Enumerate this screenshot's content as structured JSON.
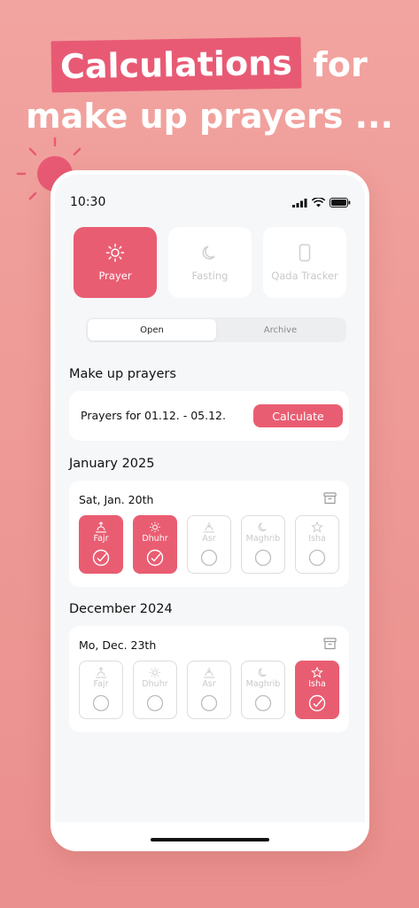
{
  "headline": {
    "highlight": "Calculations",
    "rest_line1": " for",
    "line2": "make up prayers ..."
  },
  "status_bar": {
    "time": "10:30"
  },
  "modes": [
    {
      "label": "Prayer",
      "icon": "sun-icon",
      "active": true
    },
    {
      "label": "Fasting",
      "icon": "moon-icon",
      "active": false
    },
    {
      "label": "Qada Tracker",
      "icon": "phone-icon",
      "active": false
    }
  ],
  "segment": {
    "open": "Open",
    "archive": "Archive",
    "selected": "Open"
  },
  "makeup": {
    "title": "Make up prayers",
    "range_text": "Prayers for 01.12. - 05.12.",
    "button": "Calculate"
  },
  "months": [
    {
      "title": "January 2025",
      "day": "Sat, Jan. 20th",
      "prayers": [
        {
          "name": "Fajr",
          "done": true
        },
        {
          "name": "Dhuhr",
          "done": true
        },
        {
          "name": "Asr",
          "done": false
        },
        {
          "name": "Maghrib",
          "done": false
        },
        {
          "name": "Isha",
          "done": false
        }
      ]
    },
    {
      "title": "December 2024",
      "day": "Mo, Dec. 23th",
      "prayers": [
        {
          "name": "Fajr",
          "done": false
        },
        {
          "name": "Dhuhr",
          "done": false
        },
        {
          "name": "Asr",
          "done": false
        },
        {
          "name": "Maghrib",
          "done": false
        },
        {
          "name": "Isha",
          "done": true
        }
      ]
    }
  ],
  "colors": {
    "accent": "#e95d72",
    "background": "#f2a4a0",
    "inactive": "#c9c9c9"
  }
}
